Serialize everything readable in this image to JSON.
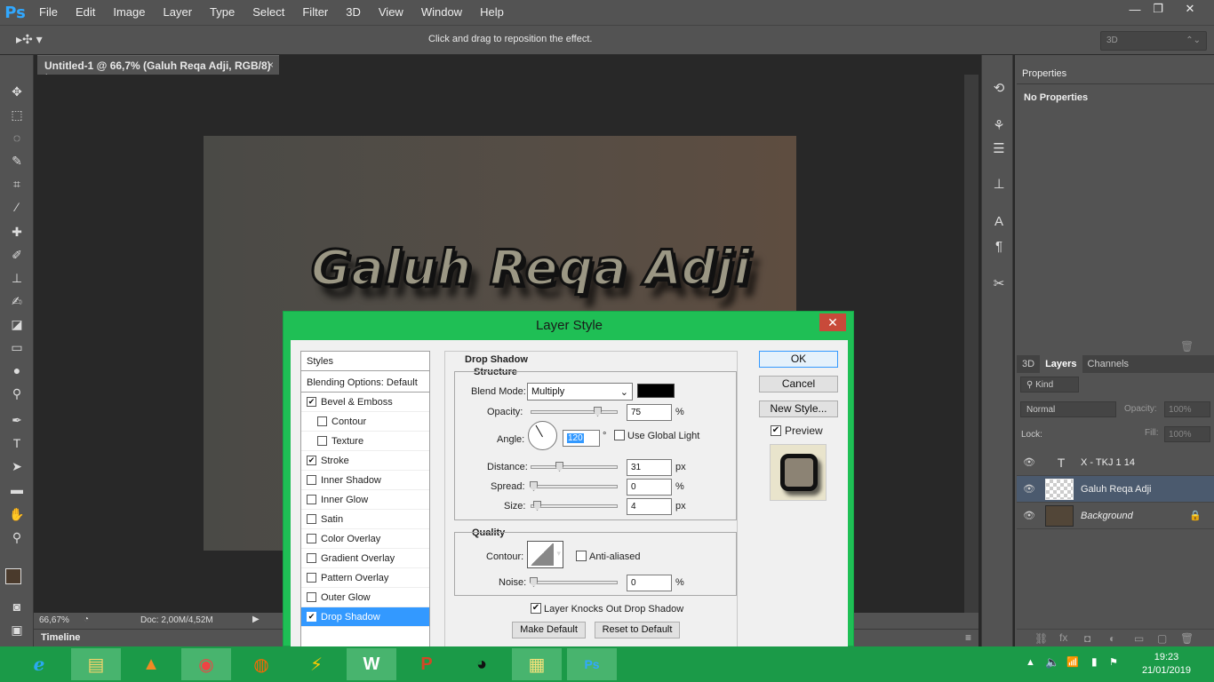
{
  "app": {
    "logo": "Ps",
    "accent": "#31a8ff"
  },
  "menu": [
    "File",
    "Edit",
    "Image",
    "Layer",
    "Type",
    "Select",
    "Filter",
    "3D",
    "View",
    "Window",
    "Help"
  ],
  "window_controls": {
    "minimize": "—",
    "restore": "❐",
    "close": "✕"
  },
  "options_bar": {
    "hint": "Click and drag to reposition the effect.",
    "mode": "3D"
  },
  "document": {
    "tab_title": "Untitled-1 @ 66,7% (Galuh Reqa Adji, RGB/8) *",
    "tab_close": "×",
    "art_text": "Galuh Reqa Adji"
  },
  "status": {
    "zoom": "66,67%",
    "doc": "Doc: 2,00M/4,52M"
  },
  "timeline": {
    "label": "Timeline"
  },
  "properties": {
    "tab": "Properties",
    "message": "No Properties"
  },
  "layers": {
    "tabs": [
      "3D",
      "Layers",
      "Channels"
    ],
    "filter": "Kind",
    "blend": "Normal",
    "opacity_label": "Opacity:",
    "opacity": "100%",
    "lock_label": "Lock:",
    "fill_label": "Fill:",
    "fill": "100%",
    "items": [
      {
        "type": "T",
        "name": "X - TKJ 1 14",
        "selected": false
      },
      {
        "type": "layer",
        "name": "Galuh Reqa Adji",
        "selected": true
      },
      {
        "type": "layer",
        "name": "Background",
        "selected": false
      }
    ]
  },
  "dialog": {
    "title": "Layer Style",
    "close": "✕",
    "styles": [
      {
        "label": "Styles",
        "checkbox": false,
        "checked": false,
        "header": true
      },
      {
        "label": "Blending Options: Default",
        "checkbox": false,
        "checked": false,
        "header": true
      },
      {
        "label": "Bevel & Emboss",
        "checkbox": true,
        "checked": true
      },
      {
        "label": "Contour",
        "checkbox": true,
        "checked": false,
        "indent": true
      },
      {
        "label": "Texture",
        "checkbox": true,
        "checked": false,
        "indent": true
      },
      {
        "label": "Stroke",
        "checkbox": true,
        "checked": true
      },
      {
        "label": "Inner Shadow",
        "checkbox": true,
        "checked": false
      },
      {
        "label": "Inner Glow",
        "checkbox": true,
        "checked": false
      },
      {
        "label": "Satin",
        "checkbox": true,
        "checked": false
      },
      {
        "label": "Color Overlay",
        "checkbox": true,
        "checked": false
      },
      {
        "label": "Gradient Overlay",
        "checkbox": true,
        "checked": false
      },
      {
        "label": "Pattern Overlay",
        "checkbox": true,
        "checked": false
      },
      {
        "label": "Outer Glow",
        "checkbox": true,
        "checked": false
      },
      {
        "label": "Drop Shadow",
        "checkbox": true,
        "checked": true,
        "selected": true
      }
    ],
    "drop_shadow": {
      "section": "Drop Shadow",
      "structure": "Structure",
      "blend_mode_label": "Blend Mode:",
      "blend_mode": "Multiply",
      "shadow_color": "#000000",
      "opacity_label": "Opacity:",
      "opacity": "75",
      "angle_label": "Angle:",
      "angle": "120",
      "degree": "°",
      "use_global_light": "Use Global Light",
      "distance_label": "Distance:",
      "distance": "31",
      "spread_label": "Spread:",
      "spread": "0",
      "size_label": "Size:",
      "size": "4",
      "unit_px": "px",
      "unit_pct": "%",
      "quality": "Quality",
      "contour_label": "Contour:",
      "anti_aliased": "Anti-aliased",
      "noise_label": "Noise:",
      "noise": "0",
      "knocks_out": "Layer Knocks Out Drop Shadow",
      "make_default": "Make Default",
      "reset_default": "Reset to Default"
    },
    "buttons": {
      "ok": "OK",
      "cancel": "Cancel",
      "new_style": "New Style...",
      "preview": "Preview"
    }
  },
  "taskbar": {
    "time": "19:23",
    "date": "21/01/2019",
    "color": "#1b9a48"
  }
}
